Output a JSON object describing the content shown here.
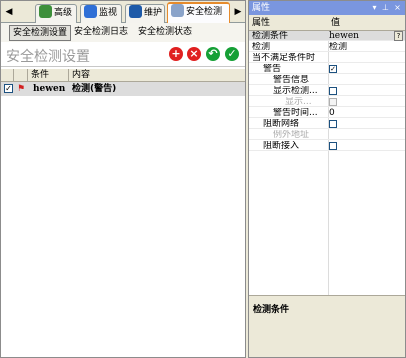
{
  "tabs": [
    {
      "label": "高级",
      "icon": "advanced-icon",
      "active": false
    },
    {
      "label": "监视",
      "icon": "monitor-icon",
      "active": false
    },
    {
      "label": "维护",
      "icon": "maintenance-icon",
      "active": false
    },
    {
      "label": "安全检测",
      "icon": "security-check-icon",
      "active": true
    }
  ],
  "subtabs": [
    "安全检测设置",
    "安全检测日志",
    "安全检测状态"
  ],
  "heading": "安全检测设置",
  "actions": [
    {
      "name": "add",
      "glyph": "+",
      "color": "#e02020"
    },
    {
      "name": "delete",
      "glyph": "×",
      "color": "#e02020"
    },
    {
      "name": "undo",
      "glyph": "↶",
      "color": "#16a036"
    },
    {
      "name": "apply",
      "glyph": "✓",
      "color": "#16a036"
    }
  ],
  "grid": {
    "headers": [
      "条件",
      "内容"
    ],
    "rows": [
      {
        "checked": true,
        "condition": "hewen",
        "content": "检测(警告)"
      }
    ]
  },
  "properties": {
    "title": "属性",
    "col_name": "属性",
    "col_value": "值",
    "rows": [
      {
        "name": "检测条件",
        "value": "hewen"
      },
      {
        "name": "检测",
        "value": "检测"
      },
      {
        "name": "当不满足条件时",
        "value": ""
      },
      {
        "name": "警告",
        "check": "on"
      },
      {
        "name": "警告信息",
        "value": ""
      },
      {
        "name": "显示检测...",
        "check": "off"
      },
      {
        "name": "显示...",
        "check": "disabled"
      },
      {
        "name": "警告时间...",
        "value": "0"
      },
      {
        "name": "阻断网络",
        "check": "off"
      },
      {
        "name": "例外地址",
        "value": ""
      },
      {
        "name": "阻断接入",
        "check": "off"
      }
    ],
    "description_title": "检测条件",
    "ellipsis": "?"
  }
}
